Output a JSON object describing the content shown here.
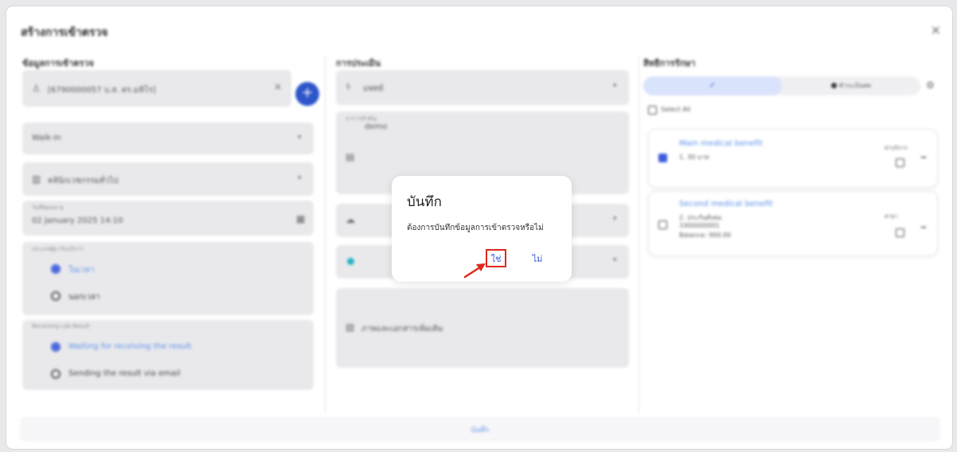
{
  "window": {
    "title": "สร้างการเข้าตรวจ",
    "close_glyph": "×"
  },
  "left": {
    "title": "ข้อมูลการเข้าตรวจ",
    "patient_value": "[6790000057 บ.ส. ตร.มหิโร]",
    "clear_glyph": "×",
    "add_glyph": "+",
    "visit_type": "Walk-In",
    "department": "คลินิกเวชกรรมทั่วไป",
    "date_label": "วันที่นัดหมาย",
    "date_value": "02 January 2025 14:10",
    "type_label": "ประเภทผู้มารับบริการ",
    "type_opt1": "ในเวลา",
    "type_opt2": "นอกเวลา",
    "lab_label": "Receiving Lab Result",
    "lab_opt1": "Waiting for receiving the result",
    "lab_opt2": "Sending the result via email"
  },
  "middle": {
    "title": "การประเมิน",
    "doctor": "แพทย์",
    "note_label": "อาการสำคัญ",
    "note_value": "demo",
    "attach_text": "ภาพและเอกสารเพิ่มเติม"
  },
  "right": {
    "title": "สิทธิการรักษา",
    "seg_check": "✓",
    "seg_other": "ชำระเงินสด",
    "select_all": "Select All",
    "benefit1_title": "Main medical benefit",
    "benefit1_line1": "1. 30 บาท",
    "benefit1_side": "ค่าบริการ",
    "benefit2_title": "Second medical benefit",
    "benefit2_line1": "2. ประกันสังคม",
    "benefit2_line2": "3300000001",
    "benefit2_line3": "Balance: 900.00",
    "benefit2_side": "ค่ายา"
  },
  "footer": {
    "save_label": "บันทึก"
  },
  "dialog": {
    "title": "บันทึก",
    "message": "ต้องการบันทึกข้อมูลการเข้าตรวจหรือไม่",
    "yes_label": "ใช่",
    "no_label": "ไม่"
  },
  "colors": {
    "accent": "#3b5bdb",
    "highlight_box": "#e0281e",
    "arrow": "#e0281e"
  }
}
